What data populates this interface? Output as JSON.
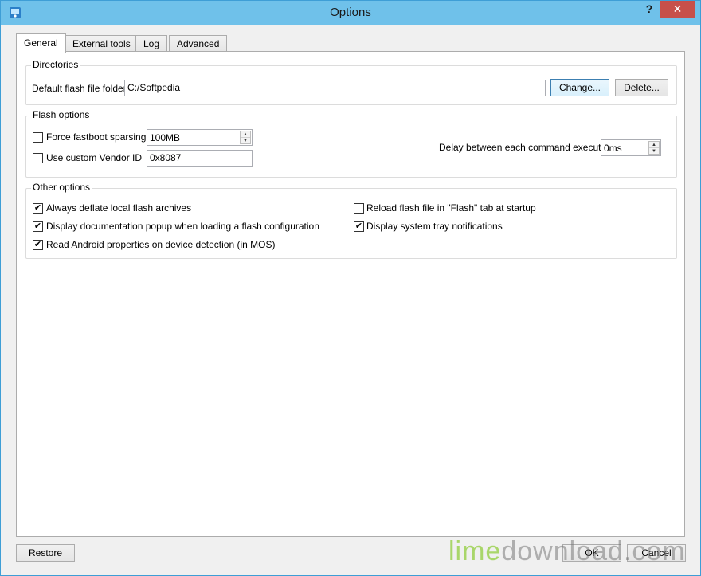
{
  "window": {
    "title": "Options",
    "help": "?",
    "close": "✕"
  },
  "tabs": [
    {
      "label": "General",
      "active": true
    },
    {
      "label": "External tools"
    },
    {
      "label": "Log"
    },
    {
      "label": "Advanced"
    }
  ],
  "directories": {
    "title": "Directories",
    "folder_label": "Default flash file folder",
    "folder_value": "C:/Softpedia",
    "change_button": "Change...",
    "delete_button": "Delete..."
  },
  "flash_options": {
    "title": "Flash options",
    "fastboot_label": "Force fastboot sparsing",
    "fastboot_checked": false,
    "fastboot_value": "100MB",
    "vendor_label": "Use custom Vendor ID",
    "vendor_checked": false,
    "vendor_value": "0x8087",
    "delay_label": "Delay between each command execution",
    "delay_value": "0ms"
  },
  "other_options": {
    "title": "Other options",
    "items": [
      {
        "label": "Always deflate local flash archives",
        "checked": true
      },
      {
        "label": "Display documentation popup when loading a flash configuration",
        "checked": true
      },
      {
        "label": "Read Android properties on device detection (in MOS)",
        "checked": true
      },
      {
        "label": "Reload flash file in \"Flash\" tab at startup",
        "checked": false
      },
      {
        "label": "Display system tray notifications",
        "checked": true
      }
    ]
  },
  "footer": {
    "restore": "Restore",
    "ok": "OK",
    "cancel": "Cancel"
  },
  "watermark": {
    "lime": "lime",
    "rest": "download.com"
  },
  "check_mark": "✔"
}
